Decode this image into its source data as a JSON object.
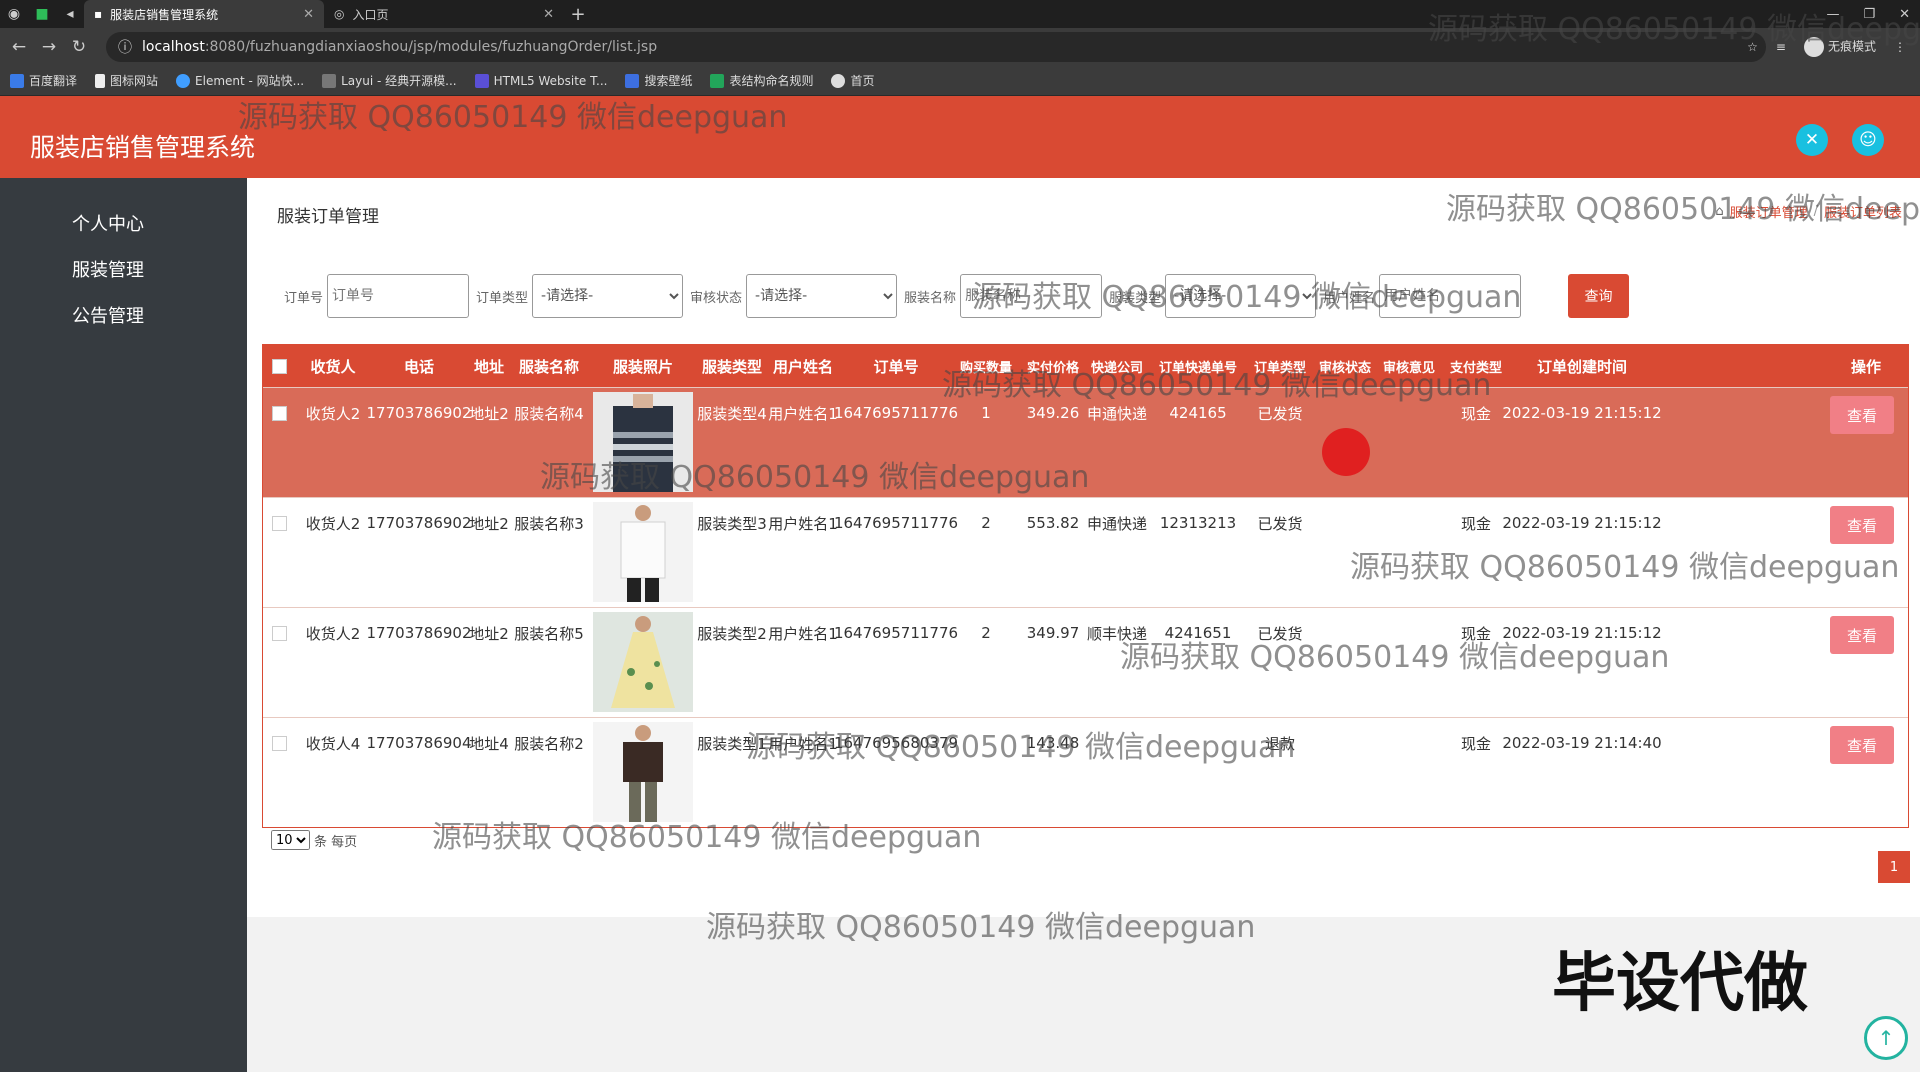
{
  "browser": {
    "tabs": [
      {
        "title": "服装店销售管理系统",
        "active": true
      },
      {
        "title": "入口页",
        "active": false
      }
    ],
    "url_host": "localhost",
    "url_path": ":8080/fuzhuangdianxiaoshou/jsp/modules/fuzhuangOrder/list.jsp",
    "profile_label": "无痕模式",
    "bookmarks": [
      "百度翻译",
      "图标网站",
      "Element - 网站快...",
      "Layui - 经典开源模...",
      "HTML5 Website T...",
      "搜索壁纸",
      "表结构命名规则",
      "首页"
    ]
  },
  "header": {
    "title": "服装店销售管理系统"
  },
  "sidebar": {
    "items": [
      {
        "label": "个人中心"
      },
      {
        "label": "服装管理"
      },
      {
        "label": "公告管理"
      }
    ]
  },
  "page": {
    "title": "服装订单管理",
    "breadcrumb": [
      "服装订单管理",
      "服装订单列表"
    ]
  },
  "search": {
    "order_no_label": "订单号",
    "order_no_placeholder": "订单号",
    "order_type_label": "订单类型",
    "order_type_value": "-请选择-",
    "audit_label": "审核状态",
    "audit_value": "-请选择-",
    "goods_name_label": "服装名称",
    "goods_name_placeholder": "服装名称",
    "goods_type_label": "服装类型",
    "goods_type_value": "-请选择-",
    "user_label": "用户姓名",
    "user_placeholder": "用户姓名",
    "query_label": "查询"
  },
  "table": {
    "columns": [
      "收货人",
      "电话",
      "地址",
      "服装名称",
      "服装照片",
      "服装类型",
      "用户姓名",
      "订单号",
      "购买数量",
      "实付价格",
      "快递公司",
      "订单快递单号",
      "订单类型",
      "审核状态",
      "审核意见",
      "支付类型",
      "订单创建时间",
      "操作"
    ],
    "view_label": "查看",
    "rows": [
      {
        "receiver": "收货人2",
        "phone": "17703786902",
        "address": "地址2",
        "goods": "服装名称4",
        "type": "服装类型4",
        "user": "用户姓名1",
        "order_no": "1647695711776",
        "qty": "1",
        "price": "349.26",
        "express": "申通快递",
        "express_no": "424165",
        "order_type": "已发货",
        "pay": "现金",
        "time": "2022-03-19 21:15:12"
      },
      {
        "receiver": "收货人2",
        "phone": "17703786902",
        "address": "地址2",
        "goods": "服装名称3",
        "type": "服装类型3",
        "user": "用户姓名1",
        "order_no": "1647695711776",
        "qty": "2",
        "price": "553.82",
        "express": "申通快递",
        "express_no": "12313213",
        "order_type": "已发货",
        "pay": "现金",
        "time": "2022-03-19 21:15:12"
      },
      {
        "receiver": "收货人2",
        "phone": "17703786902",
        "address": "地址2",
        "goods": "服装名称5",
        "type": "服装类型2",
        "user": "用户姓名1",
        "order_no": "1647695711776",
        "qty": "2",
        "price": "349.97",
        "express": "顺丰快递",
        "express_no": "4241651",
        "order_type": "已发货",
        "pay": "现金",
        "time": "2022-03-19 21:15:12"
      },
      {
        "receiver": "收货人4",
        "phone": "17703786904",
        "address": "地址4",
        "goods": "服装名称2",
        "type": "服装类型1",
        "user": "用户姓名1",
        "order_no": "1647695680379",
        "qty": "",
        "price": "143.48",
        "express": "",
        "express_no": "",
        "order_type": "退款",
        "pay": "现金",
        "time": "2022-03-19 21:14:40"
      }
    ]
  },
  "pager": {
    "size": "10",
    "suffix": "条 每页",
    "current": "1"
  },
  "watermark": {
    "text": "源码获取 QQ86050149 微信deepguan",
    "big": "毕设代做"
  },
  "colors": {
    "primary": "#d94a33",
    "sidebar": "#363b40",
    "view_btn": "#f17f86",
    "accent": "#19c0e0"
  }
}
